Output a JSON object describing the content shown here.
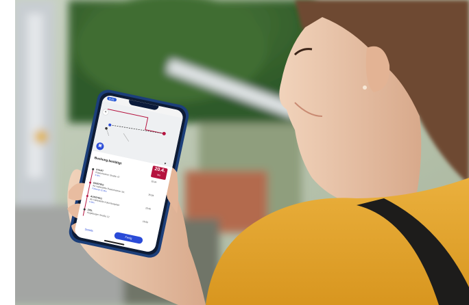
{
  "image": {
    "description_colors": {
      "sweater": "#e0a12a",
      "skin": "#e9c3a6",
      "hair": "#6b4230",
      "foliage": "#3b6a2f",
      "phone_frame": "#1c3f7a",
      "accent_blue": "#2a4bd7",
      "accent_red": "#b5123e"
    }
  },
  "phone": {
    "status_time": "9:41",
    "app": {
      "booking_title": "Buchung bestätigt",
      "date_day": "20.4.",
      "date_sub": "Mo",
      "stops": [
        {
          "label": "START",
          "address": "Rosenheimer Straße 47",
          "time": "15:24",
          "meta": "5 Min."
        },
        {
          "label": "EINSTIEG",
          "address": "Ab Haltestelle Rosenheimer Str.",
          "time": "15:33",
          "meta": "Fahrtzeit 12 Min."
        },
        {
          "label": "AUSSTIEG",
          "address": "Ab Haltestelle Kolumbusplatz",
          "time": "15:45",
          "meta": "5 Min."
        },
        {
          "label": "ZIEL",
          "address": "Augsburger Straße 12",
          "time": "15:50"
        }
      ],
      "details_label": "Details",
      "done_label": "Fertig"
    }
  }
}
